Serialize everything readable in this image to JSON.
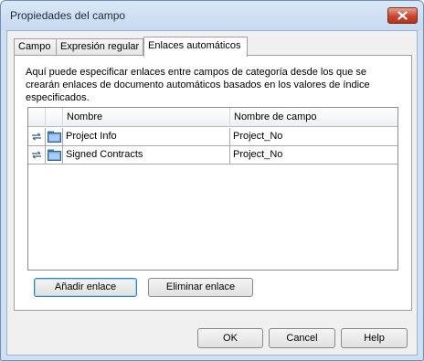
{
  "window": {
    "title": "Propiedades del campo",
    "close_icon": "close-icon"
  },
  "tabs": [
    {
      "label": "Campo",
      "active": false
    },
    {
      "label": "Expresión regular",
      "active": false
    },
    {
      "label": "Enlaces automáticos",
      "active": true
    }
  ],
  "panel": {
    "description": "Aquí puede especificar enlaces entre campos de categoría desde los que se crearán enlaces de documento automáticos basados en los valores de índice especificados.",
    "columns": [
      "",
      "",
      "Nombre",
      "Nombre de campo"
    ],
    "rows": [
      {
        "link_icon": "link-arrows-icon",
        "folder_icon": "folder-icon",
        "name": "Project Info",
        "field": "Project_No"
      },
      {
        "link_icon": "link-arrows-icon",
        "folder_icon": "folder-icon",
        "name": "Signed Contracts",
        "field": "Project_No"
      }
    ],
    "add_button": "Añadir enlace",
    "remove_button": "Eliminar enlace"
  },
  "footer": {
    "ok": "OK",
    "cancel": "Cancel",
    "help": "Help"
  },
  "colors": {
    "title_bar": "#c6d9ee",
    "close_button": "#c7452f",
    "dialog_background": "#f0f0f0",
    "focus_border": "#3c7fb1"
  }
}
